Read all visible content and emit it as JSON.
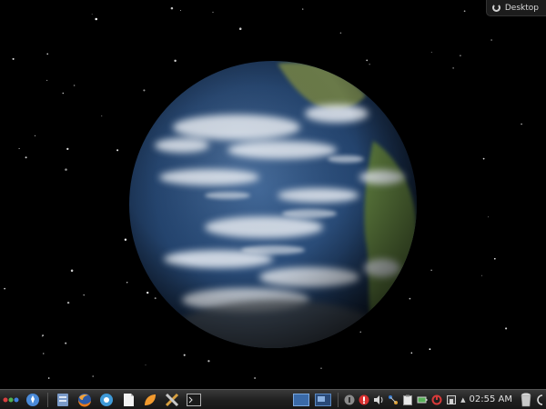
{
  "desktop_toolbox": {
    "label": "Desktop"
  },
  "panel": {
    "clock": "02:55 AM",
    "launchers": [
      "application-launcher-icon",
      "file-manager-icon",
      "firefox-icon",
      "software-center-icon",
      "text-editor-icon",
      "orange-app-icon",
      "settings-tools-icon",
      "terminal-icon"
    ],
    "tray": [
      "network-icon",
      "update-notifier-icon",
      "volume-icon",
      "wifi-icon",
      "clipboard-icon",
      "battery-icon",
      "power-icon",
      "device-icon"
    ]
  },
  "colors": {
    "panel_bg": "#1f1f1f",
    "clock_text": "#e0e0e0",
    "ocean": "#2a4a7a",
    "land": "#5a7a3a"
  }
}
